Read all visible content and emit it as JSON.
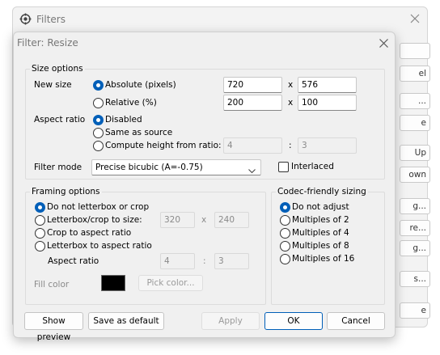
{
  "background_window": {
    "title": "Filters",
    "side_buttons": [
      "",
      "el",
      "...",
      "e",
      "Up",
      "own",
      "g...",
      "re...",
      "g...",
      "s...",
      "e"
    ]
  },
  "dialog": {
    "title": "Filter: Resize",
    "size_options": {
      "group_label": "Size options",
      "new_size_label": "New size",
      "absolute_label": "Absolute (pixels)",
      "relative_label": "Relative (%)",
      "abs_width": "720",
      "abs_height": "576",
      "rel_width": "200",
      "rel_height": "100",
      "x_sep": "x",
      "aspect_ratio_label": "Aspect ratio",
      "ar_disabled": "Disabled",
      "ar_same": "Same as source",
      "ar_compute": "Compute height from ratio:",
      "ratio_a": "4",
      "ratio_b": "3",
      "colon": ":",
      "filter_mode_label": "Filter mode",
      "filter_mode_value": "Precise bicubic (A=-0.75)",
      "interlaced_label": "Interlaced",
      "interlaced_checked": false
    },
    "framing_options": {
      "group_label": "Framing options",
      "no_letterbox": "Do not letterbox or crop",
      "letterbox_crop": "Letterbox/crop to size:",
      "lb_width": "320",
      "lb_height": "240",
      "crop_aspect": "Crop to aspect ratio",
      "letterbox_aspect": "Letterbox to aspect ratio",
      "aspect_ratio_label": "Aspect ratio",
      "ar_a": "4",
      "ar_b": "3",
      "fill_color_label": "Fill color",
      "fill_color": "#000000",
      "pick_color": "Pick color..."
    },
    "codec_sizing": {
      "group_label": "Codec-friendly sizing",
      "options": [
        "Do not adjust",
        "Multiples of 2",
        "Multiples of 4",
        "Multiples of 8",
        "Multiples of 16"
      ],
      "selected_index": 0
    },
    "buttons": {
      "show_preview": "Show preview",
      "save_default": "Save as default",
      "apply": "Apply",
      "ok": "OK",
      "cancel": "Cancel"
    }
  },
  "colors": {
    "accent": "#005fb8",
    "dialog_bg": "#f0f0f0"
  }
}
